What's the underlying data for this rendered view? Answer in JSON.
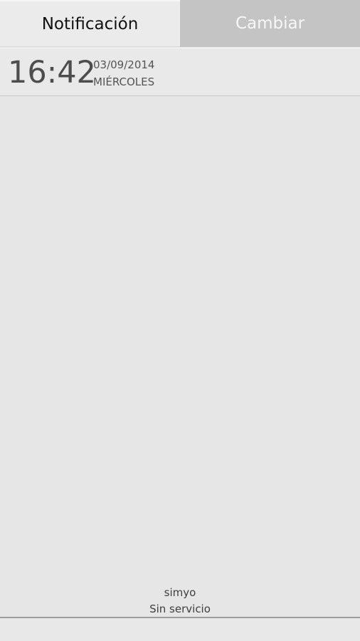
{
  "tabs": {
    "notifications_label": "Notificación",
    "toggles_label": "Cambiar"
  },
  "clock": {
    "time": "16:42",
    "date": "03/09/2014",
    "weekday": "MIÉRCOLES"
  },
  "network": {
    "carrier": "simyo",
    "status": "Sin servicio"
  }
}
